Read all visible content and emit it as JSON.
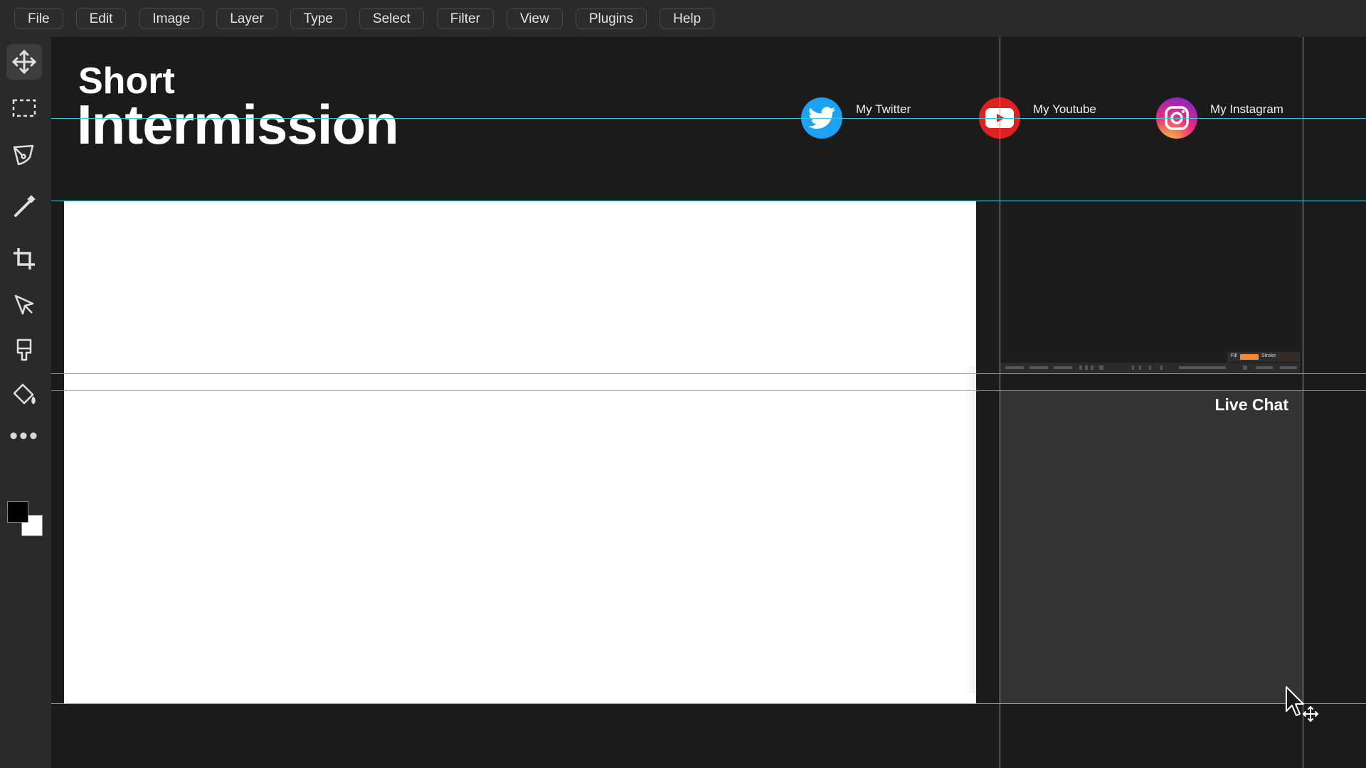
{
  "menu": {
    "items": [
      "File",
      "Edit",
      "Image",
      "Layer",
      "Type",
      "Select",
      "Filter",
      "View",
      "Plugins",
      "Help"
    ]
  },
  "tools": [
    {
      "name": "move-tool",
      "icon": "move-icon",
      "active": true
    },
    {
      "name": "marquee-tool",
      "icon": "marquee-icon"
    },
    {
      "name": "pen-tool",
      "icon": "pen-nib-icon"
    },
    {
      "name": "brush-tool",
      "icon": "brush-icon"
    },
    {
      "name": "crop-tool",
      "icon": "crop-icon"
    },
    {
      "name": "direct-select-tool",
      "icon": "arrow-select-icon"
    },
    {
      "name": "stamp-tool",
      "icon": "stamp-icon"
    },
    {
      "name": "fill-tool",
      "icon": "paint-bucket-icon"
    },
    {
      "name": "more-tools",
      "icon": "more-dots-icon"
    }
  ],
  "colors": {
    "foreground": "#000000",
    "background": "#ffffff",
    "guide": "#3fc6d4",
    "twitter": "#1da1f2",
    "youtube": "#e02020",
    "instagram_gradient": [
      "#f9ce34",
      "#ee2a7b",
      "#6228d7"
    ]
  },
  "canvas": {
    "title_short": "Short",
    "title_main": "Intermission",
    "social": [
      {
        "label": "My Twitter",
        "icon": "twitter-icon"
      },
      {
        "label": "My Youtube",
        "icon": "youtube-icon"
      },
      {
        "label": "My Instagram",
        "icon": "instagram-icon"
      }
    ],
    "mini_panel": {
      "fill_label": "Fill",
      "stroke_label": "Stroke"
    },
    "chat_title": "Live Chat"
  }
}
